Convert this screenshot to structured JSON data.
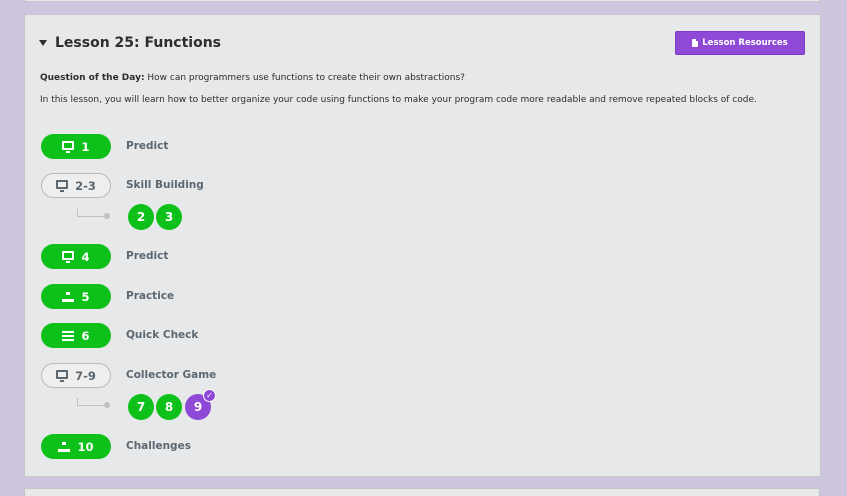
{
  "lesson": {
    "title": "Lesson 25: Functions",
    "resources_label": "Lesson Resources",
    "question_label": "Question of the Day:",
    "question_text": " How can programmers use functions to create their own abstractions?",
    "intro": "In this lesson, you will learn how to better organize your code using functions to make your program code more readable and remove repeated blocks of code."
  },
  "levels": [
    {
      "number": "1",
      "name": "Predict",
      "icon": "monitor-icon",
      "style": "green"
    },
    {
      "number": "2-3",
      "name": "Skill Building",
      "icon": "monitor-icon",
      "style": "outline",
      "sublevels": [
        {
          "label": "2",
          "status": "complete"
        },
        {
          "label": "3",
          "status": "complete"
        }
      ]
    },
    {
      "number": "4",
      "name": "Predict",
      "icon": "monitor-icon",
      "style": "green"
    },
    {
      "number": "5",
      "name": "Practice",
      "icon": "sitemap-icon",
      "style": "green"
    },
    {
      "number": "6",
      "name": "Quick Check",
      "icon": "list-icon",
      "style": "green"
    },
    {
      "number": "7-9",
      "name": "Collector Game",
      "icon": "monitor-icon",
      "style": "outline",
      "sublevels": [
        {
          "label": "7",
          "status": "complete"
        },
        {
          "label": "8",
          "status": "complete"
        },
        {
          "label": "9",
          "status": "current"
        }
      ]
    },
    {
      "number": "10",
      "name": "Challenges",
      "icon": "sitemap-icon",
      "style": "green"
    }
  ],
  "colors": {
    "page_bg": "#cdc6de",
    "card_bg": "#e7e8ea",
    "complete_green": "#0dc11a",
    "accent_purple": "#8e4ad6",
    "text_gray": "#5b6770"
  }
}
